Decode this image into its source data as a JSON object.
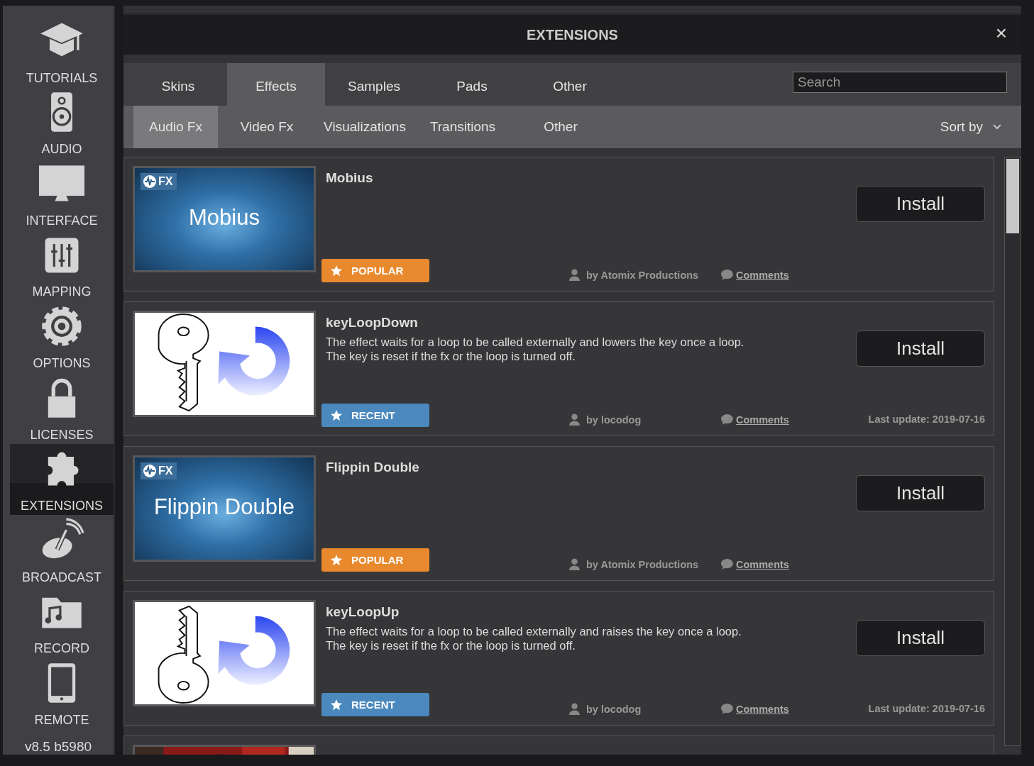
{
  "sidebar": {
    "items": [
      {
        "label": "TUTORIALS",
        "selected": false
      },
      {
        "label": "AUDIO",
        "selected": false
      },
      {
        "label": "INTERFACE",
        "selected": false
      },
      {
        "label": "MAPPING",
        "selected": false
      },
      {
        "label": "OPTIONS",
        "selected": false
      },
      {
        "label": "LICENSES",
        "selected": false
      },
      {
        "label": "EXTENSIONS",
        "selected": true
      },
      {
        "label": "BROADCAST",
        "selected": false
      },
      {
        "label": "RECORD",
        "selected": false
      },
      {
        "label": "REMOTE",
        "selected": false
      }
    ],
    "version": "v8.5 b5980"
  },
  "window": {
    "title": "EXTENSIONS",
    "close": "×"
  },
  "tabs": [
    {
      "label": "Skins",
      "selected": false
    },
    {
      "label": "Effects",
      "selected": true
    },
    {
      "label": "Samples",
      "selected": false
    },
    {
      "label": "Pads",
      "selected": false
    },
    {
      "label": "Other",
      "selected": false
    }
  ],
  "search": {
    "placeholder": "Search"
  },
  "subtabs": [
    {
      "label": "Audio Fx",
      "selected": true
    },
    {
      "label": "Video Fx",
      "selected": false
    },
    {
      "label": "Visualizations",
      "selected": false
    },
    {
      "label": "Transitions",
      "selected": false
    },
    {
      "label": "Other",
      "selected": false
    }
  ],
  "sort": {
    "label": "Sort by"
  },
  "extensions": [
    {
      "name": "Mobius",
      "thumbnail": {
        "kind": "fx",
        "badge": "FX",
        "title": "Mobius"
      },
      "badge": {
        "label": "POPULAR",
        "color": "#e8892e"
      },
      "author": "by Atomix Productions",
      "comments": "Comments",
      "button": "Install"
    },
    {
      "name": "keyLoopDown",
      "thumbnail": {
        "kind": "key-down"
      },
      "description": [
        "The effect waits for a loop to be called externally and lowers the key once a loop.",
        "The key is reset if the fx or the loop is turned off."
      ],
      "badge": {
        "label": "RECENT",
        "color": "#4a88bd"
      },
      "author": "by locodog",
      "comments": "Comments",
      "updated": "Last update: 2019-07-16",
      "button": "Install"
    },
    {
      "name": "Flippin Double",
      "thumbnail": {
        "kind": "fx",
        "badge": "FX",
        "title": "Flippin Double"
      },
      "badge": {
        "label": "POPULAR",
        "color": "#e8892e"
      },
      "author": "by Atomix Productions",
      "comments": "Comments",
      "button": "Install"
    },
    {
      "name": "keyLoopUp",
      "thumbnail": {
        "kind": "key-up"
      },
      "description": [
        "The effect waits for a loop to be called externally and raises the key once a loop.",
        "The key is reset if the fx or the loop is turned off."
      ],
      "badge": {
        "label": "RECENT",
        "color": "#4a88bd"
      },
      "author": "by locodog",
      "comments": "Comments",
      "updated": "Last update: 2019-07-16",
      "button": "Install"
    },
    {
      "thumbnail": {
        "kind": "picture"
      }
    }
  ]
}
